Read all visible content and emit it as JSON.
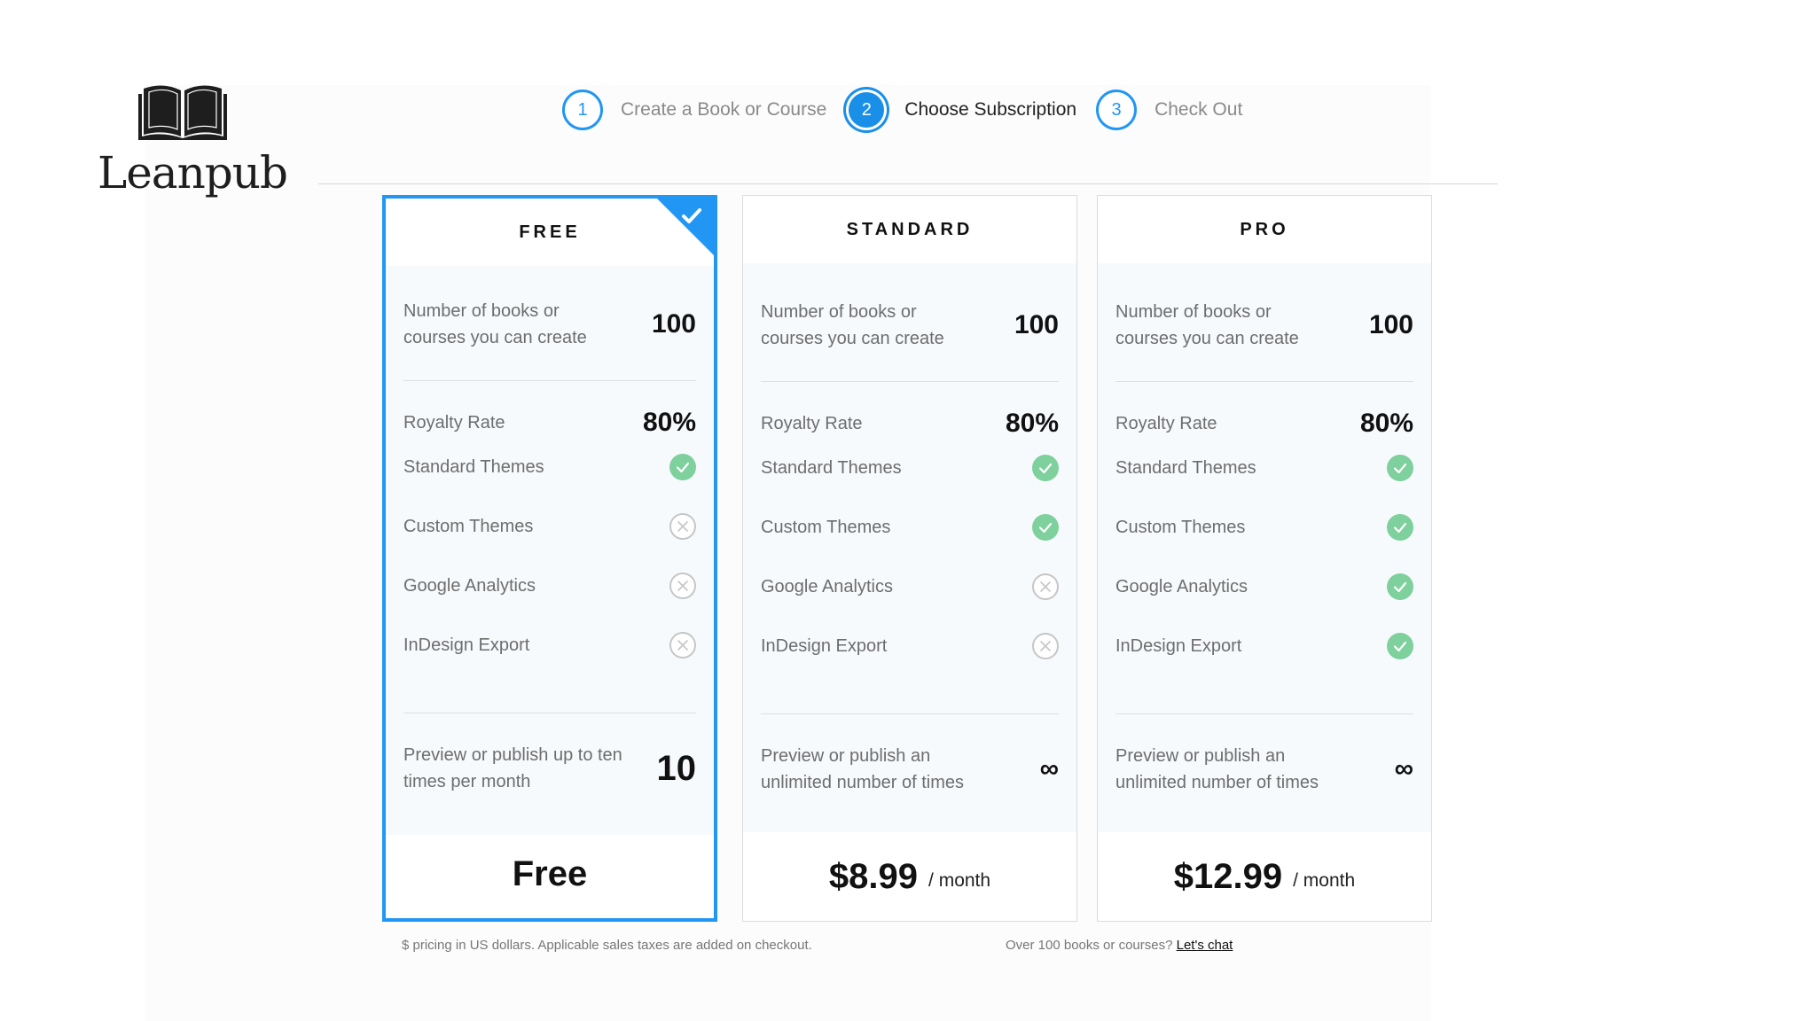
{
  "brand": {
    "name": "Leanpub"
  },
  "steps": [
    {
      "number": "1",
      "label": "Create a Book or Course",
      "active": false
    },
    {
      "number": "2",
      "label": "Choose Subscription",
      "active": true
    },
    {
      "number": "3",
      "label": "Check Out",
      "active": false
    }
  ],
  "plans": [
    {
      "name": "FREE",
      "selected": true,
      "books_label": "Number of books or courses you can create",
      "books_value": "100",
      "royalty_label": "Royalty Rate",
      "royalty_value": "80%",
      "features": [
        {
          "label": "Standard Themes",
          "included": true
        },
        {
          "label": "Custom Themes",
          "included": false
        },
        {
          "label": "Google Analytics",
          "included": false
        },
        {
          "label": "InDesign Export",
          "included": false
        }
      ],
      "publish_label": "Preview or publish up to ten times per month",
      "publish_value": "10",
      "price": "Free",
      "period": ""
    },
    {
      "name": "STANDARD",
      "selected": false,
      "books_label": "Number of books or courses you can create",
      "books_value": "100",
      "royalty_label": "Royalty Rate",
      "royalty_value": "80%",
      "features": [
        {
          "label": "Standard Themes",
          "included": true
        },
        {
          "label": "Custom Themes",
          "included": true
        },
        {
          "label": "Google Analytics",
          "included": false
        },
        {
          "label": "InDesign Export",
          "included": false
        }
      ],
      "publish_label": "Preview or publish an unlimited number of times",
      "publish_value": "∞",
      "price": "$8.99",
      "period": "/ month"
    },
    {
      "name": "PRO",
      "selected": false,
      "books_label": "Number of books or courses you can create",
      "books_value": "100",
      "royalty_label": "Royalty Rate",
      "royalty_value": "80%",
      "features": [
        {
          "label": "Standard Themes",
          "included": true
        },
        {
          "label": "Custom Themes",
          "included": true
        },
        {
          "label": "Google Analytics",
          "included": true
        },
        {
          "label": "InDesign Export",
          "included": true
        }
      ],
      "publish_label": "Preview or publish an unlimited number of times",
      "publish_value": "∞",
      "price": "$12.99",
      "period": "/ month"
    }
  ],
  "footer": {
    "pricing_note": "$ pricing in US dollars. Applicable sales taxes are added on checkout.",
    "chat_question": "Over 100 books or courses?",
    "chat_link": "Let's chat"
  },
  "colors": {
    "accent": "#2196f3",
    "check": "#7ed09c",
    "cross": "#c6c6c6"
  }
}
